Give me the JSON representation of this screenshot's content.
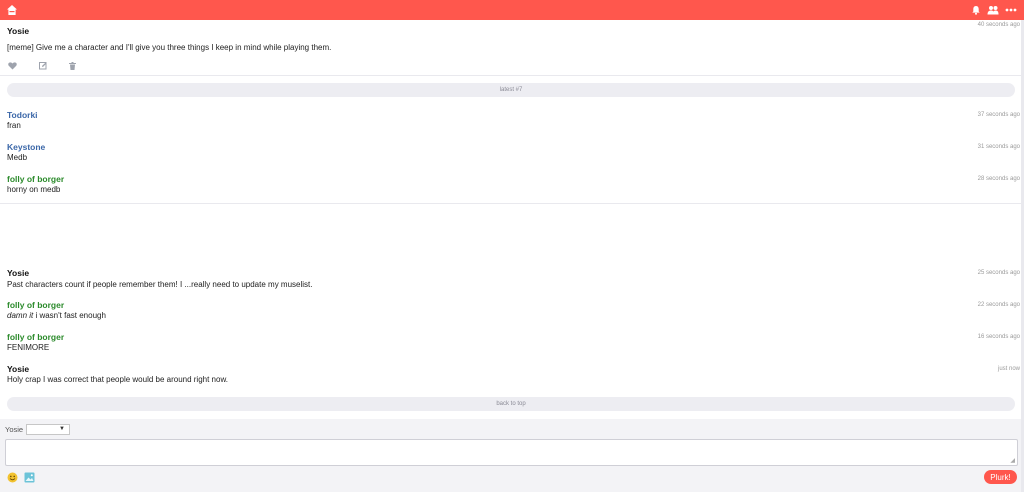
{
  "colors": {
    "brand": "#ff574d",
    "blue_user": "#3b67a8",
    "green_user": "#2a8a2a"
  },
  "topbar": {
    "icons": [
      "home-icon",
      "bell-icon",
      "friends-icon",
      "more-icon"
    ]
  },
  "post": {
    "author": "Yosie",
    "time": "40 seconds ago",
    "text": "[meme] Give me a character and I'll give you three things I keep in mind while playing them.",
    "actions": [
      "heart-icon",
      "edit-icon",
      "trash-icon"
    ]
  },
  "latest_label": "latest #7",
  "responses_a": [
    {
      "name": "Todorki",
      "text": "fran",
      "time": "37 seconds ago"
    },
    {
      "name": "Keystone",
      "text": "Medb",
      "time": "31 seconds ago"
    },
    {
      "name": "folly of borger",
      "text": "horny on medb",
      "time": "28 seconds ago"
    }
  ],
  "responses_b": [
    {
      "name": "Yosie",
      "text": "Past characters count if people remember them! I ...really need to update my muselist.",
      "time": "25 seconds ago"
    },
    {
      "name": "folly of borger",
      "text_italic": "damn it",
      "text": " i wasn't fast enough",
      "time": "22 seconds ago"
    },
    {
      "name": "folly of borger",
      "text": "FENIMORE",
      "time": "16 seconds ago"
    },
    {
      "name": "Yosie",
      "text": "Holy crap I was correct that people would be around right now.",
      "time": "just now"
    }
  ],
  "back_to_top": "back to top",
  "composer": {
    "poster_label": "Yosie",
    "qualifier_value": "",
    "submit_label": "Plurk!",
    "icons": [
      "emoticon-icon",
      "image-upload-icon"
    ]
  }
}
